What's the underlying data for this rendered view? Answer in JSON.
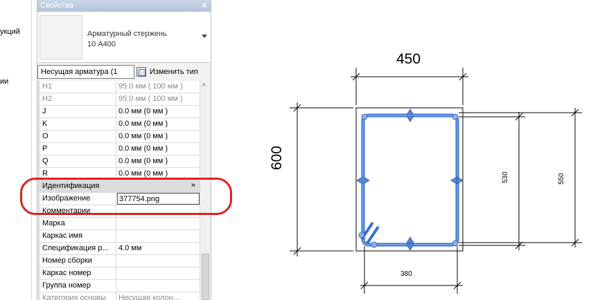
{
  "left_panel": {
    "labels": [
      "укций",
      "ии"
    ]
  },
  "properties": {
    "title": "Свойства",
    "type_selector": {
      "line1": "Арматурный стержень",
      "line2": "10 А400"
    },
    "filter_value": "Несущая арматура (1",
    "edit_type_label": "Изменить тип",
    "rows": [
      {
        "name": "H1",
        "value": "95.0 мм ( 100 мм )"
      },
      {
        "name": "H2",
        "value": "95.0 мм ( 100 мм )"
      },
      {
        "name": "J",
        "value": "0.0 мм (0 мм )"
      },
      {
        "name": "K",
        "value": "0.0 мм (0 мм )"
      },
      {
        "name": "O",
        "value": "0.0 мм (0 мм )"
      },
      {
        "name": "P",
        "value": "0.0 мм (0 мм )"
      },
      {
        "name": "Q",
        "value": "0.0 мм (0 мм )"
      },
      {
        "name": "R",
        "value": "0.0 мм (0 мм )"
      }
    ],
    "group_identification": "Идентификация",
    "group_chevron": "»",
    "identification_rows": [
      {
        "name": "Изображение",
        "value": "377754.png"
      },
      {
        "name": "Комментарии",
        "value": ""
      },
      {
        "name": "Марка",
        "value": ""
      },
      {
        "name": "Каркас имя",
        "value": ""
      },
      {
        "name": "Спецификация р...",
        "value": "4.0 мм"
      },
      {
        "name": "Номер сборки",
        "value": ""
      },
      {
        "name": "Каркас номер",
        "value": ""
      },
      {
        "name": "Группа номер",
        "value": ""
      },
      {
        "name": "Категория основы",
        "value": "Несущая колон..."
      }
    ]
  },
  "drawing": {
    "dims": {
      "top": "450",
      "left": "600",
      "bottom": "380",
      "inner_height": "530",
      "outer_height": "550"
    },
    "colors": {
      "rebar": "#3a6fd0",
      "highlight": "#e02020"
    }
  }
}
